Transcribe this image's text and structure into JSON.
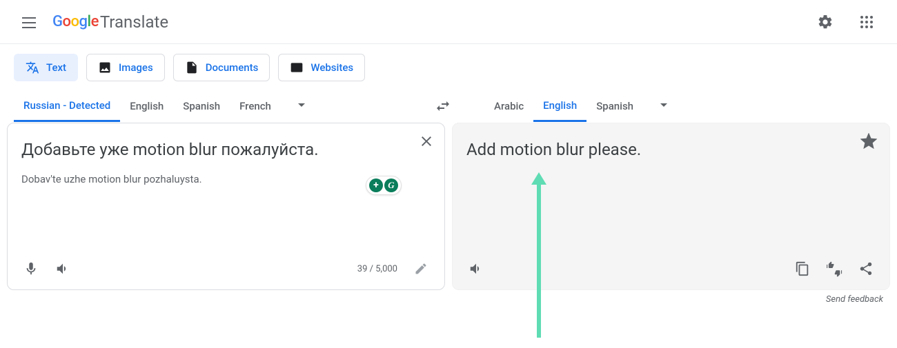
{
  "header": {
    "logo_translate": "Translate"
  },
  "modes": [
    {
      "key": "text",
      "label": "Text",
      "active": true
    },
    {
      "key": "images",
      "label": "Images",
      "active": false
    },
    {
      "key": "documents",
      "label": "Documents",
      "active": false
    },
    {
      "key": "websites",
      "label": "Websites",
      "active": false
    }
  ],
  "source_langs": {
    "tabs": [
      "Russian - Detected",
      "English",
      "Spanish",
      "French"
    ],
    "active_index": 0
  },
  "target_langs": {
    "tabs": [
      "Arabic",
      "English",
      "Spanish"
    ],
    "active_index": 1
  },
  "source": {
    "text": "Добавьте уже motion blur пожалуйста.",
    "transliteration": "Dobav'te uzhe motion blur pozhaluysta.",
    "char_count": "39 / 5,000"
  },
  "output": {
    "text": "Add motion blur please."
  },
  "feedback_label": "Send feedback"
}
